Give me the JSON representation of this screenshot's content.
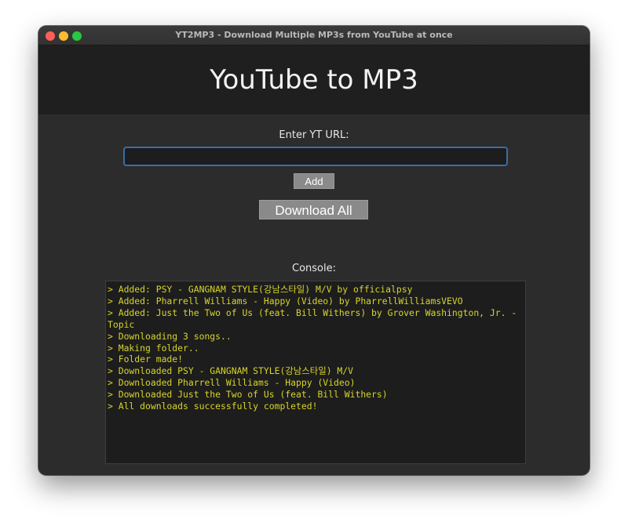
{
  "window": {
    "title": "YT2MP3 - Download Multiple MP3s from YouTube at once"
  },
  "header": {
    "title": "YouTube to MP3"
  },
  "form": {
    "url_label": "Enter YT URL:",
    "url_value": "",
    "add_label": "Add",
    "download_all_label": "Download All"
  },
  "console": {
    "label": "Console:",
    "lines": [
      "> Added: PSY - GANGNAM STYLE(강남스타일) M/V by officialpsy",
      "> Added: Pharrell Williams - Happy (Video) by PharrellWilliamsVEVO",
      "> Added: Just the Two of Us (feat. Bill Withers) by Grover Washington, Jr. - Topic",
      "> Downloading 3 songs..",
      "> Making folder..",
      "> Folder made!",
      "> Downloaded PSY - GANGNAM STYLE(강남스타일) M/V",
      "> Downloaded Pharrell Williams - Happy (Video)",
      "> Downloaded Just the Two of Us (feat. Bill Withers)",
      "> All downloads successfully completed!"
    ]
  },
  "colors": {
    "window_bg": "#2c2c2c",
    "header_bg": "#1f1f1f",
    "console_text": "#d7d52a",
    "button_bg": "#8a8a8a",
    "input_focus": "#3a6ea5"
  }
}
